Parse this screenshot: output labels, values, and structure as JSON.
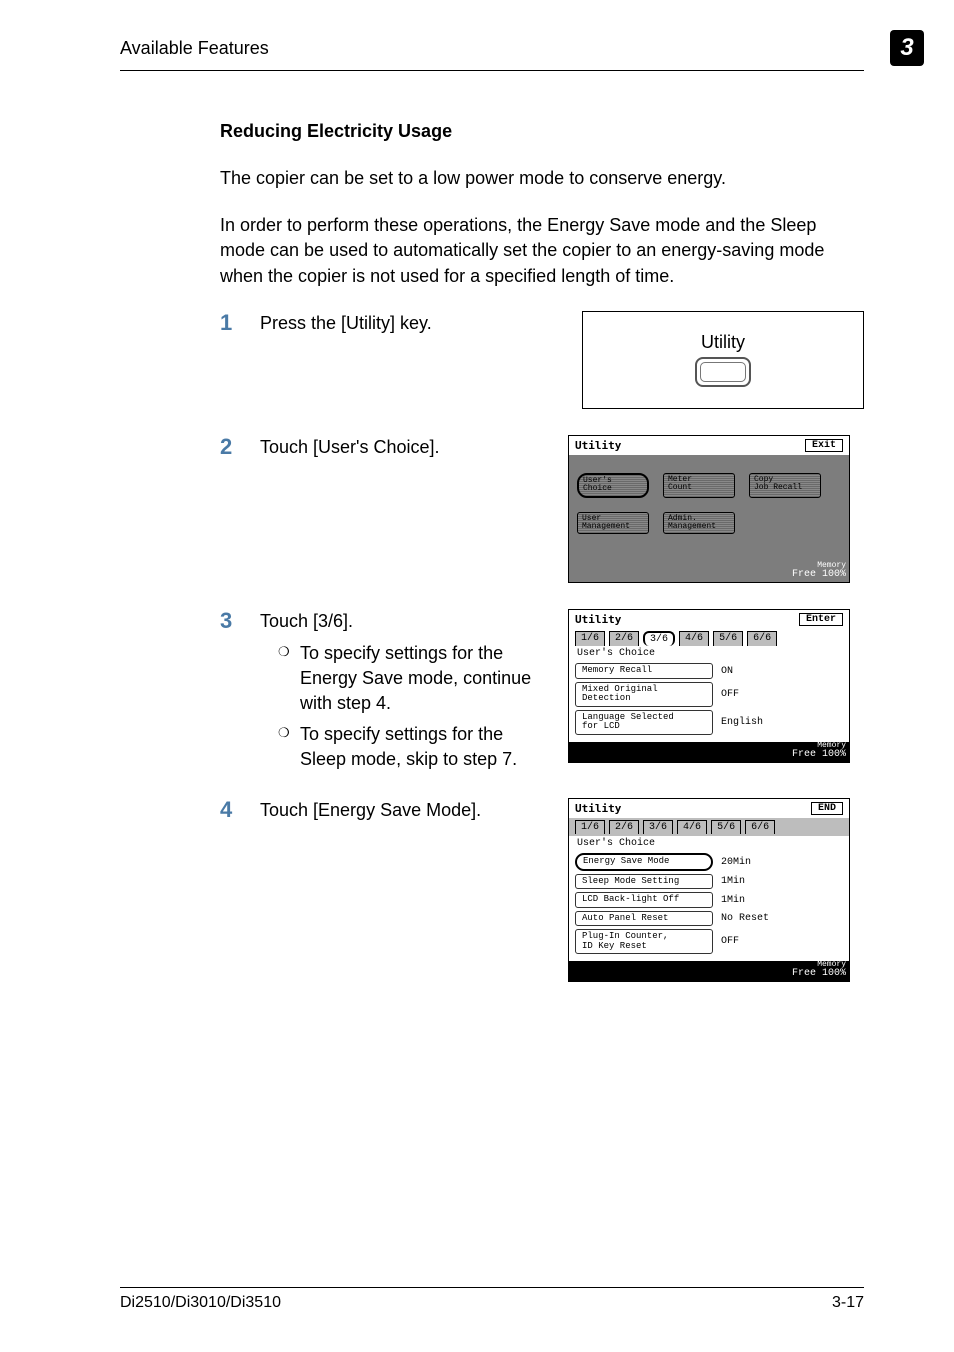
{
  "header": {
    "section": "Available Features",
    "chapter": "3"
  },
  "heading": "Reducing Electricity Usage",
  "intro1": "The copier can be set to a low power mode to conserve energy.",
  "intro2": "In order to perform these operations, the Energy Save mode and the Sleep mode can be used to automatically set the copier to an energy-saving mode when the copier is not used for a specified length of time.",
  "steps": {
    "s1": {
      "num": "1",
      "text": "Press the [Utility] key.",
      "keylabel": "Utility"
    },
    "s2": {
      "num": "2",
      "text": "Touch [User's Choice].",
      "lcd": {
        "title": "Utility",
        "exit": "Exit",
        "btn_users_choice": "User's\nChoice",
        "btn_meter_count": "Meter\nCount",
        "btn_copy_recall": "Copy\nJob Recall",
        "btn_user_mgmt": "User\nManagement",
        "btn_admin_mgmt": "Admin.\nManagement",
        "memory_label": "Memory",
        "memory_free": "Free",
        "memory_pct": "100%"
      }
    },
    "s3": {
      "num": "3",
      "text": "Touch [3/6].",
      "sub1": "To specify settings for the Energy Save mode, continue with step 4.",
      "sub2": "To specify settings for the Sleep mode, skip to step 7.",
      "lcd": {
        "title": "Utility",
        "enter": "Enter",
        "tabs": [
          "1/6",
          "2/6",
          "3/6",
          "4/6",
          "5/6",
          "6/6"
        ],
        "subtitle": "User's Choice",
        "rows": [
          {
            "label": "Memory Recall",
            "value": "ON"
          },
          {
            "label": "Mixed Original\nDetection",
            "value": "OFF"
          },
          {
            "label": "Language Selected\nfor LCD",
            "value": "English"
          }
        ],
        "memory_label": "Memory",
        "memory_free": "Free",
        "memory_pct": "100%"
      }
    },
    "s4": {
      "num": "4",
      "text": "Touch [Energy Save Mode].",
      "lcd": {
        "title": "Utility",
        "end": "END",
        "tabs": [
          "1/6",
          "2/6",
          "3/6",
          "4/6",
          "5/6",
          "6/6"
        ],
        "subtitle": "User's Choice",
        "rows": [
          {
            "label": "Energy Save Mode",
            "value": "20Min",
            "sel": true
          },
          {
            "label": "Sleep Mode Setting",
            "value": "1Min"
          },
          {
            "label": "LCD Back-light Off",
            "value": "1Min"
          },
          {
            "label": "Auto Panel Reset",
            "value": "No Reset"
          },
          {
            "label": "Plug-In Counter,\nID Key Reset",
            "value": "OFF"
          }
        ],
        "memory_label": "Memory",
        "memory_free": "Free",
        "memory_pct": "100%"
      }
    }
  },
  "footer": {
    "model": "Di2510/Di3010/Di3510",
    "page": "3-17"
  }
}
